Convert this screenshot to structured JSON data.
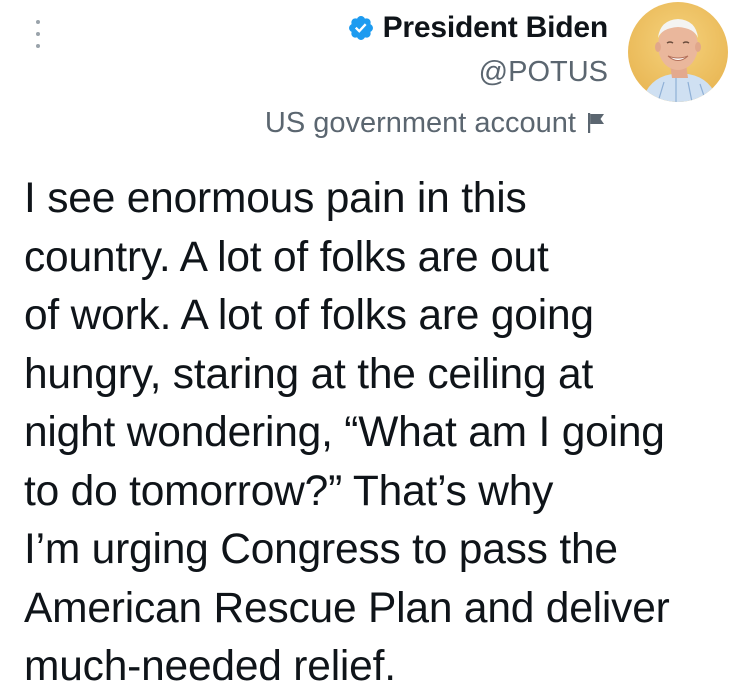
{
  "header": {
    "display_name": "President Biden",
    "handle": "@POTUS",
    "account_label": "US government account",
    "verified_icon": "verified-badge-icon",
    "label_icon": "flag-icon",
    "more_icon": "more-vertical-icon",
    "accent_color": "#1d9bf0"
  },
  "avatar": {
    "icon": "profile-photo"
  },
  "tweet": {
    "lines": [
      "I see enormous pain in this",
      "country. A lot of folks are out",
      "of work. A lot of folks are going",
      "hungry, staring at the ceiling at",
      "night wondering, “What am I going",
      "to do tomorrow?” That’s why",
      "I’m urging Congress to pass the",
      "American Rescue Plan and deliver",
      "much-needed relief."
    ]
  }
}
